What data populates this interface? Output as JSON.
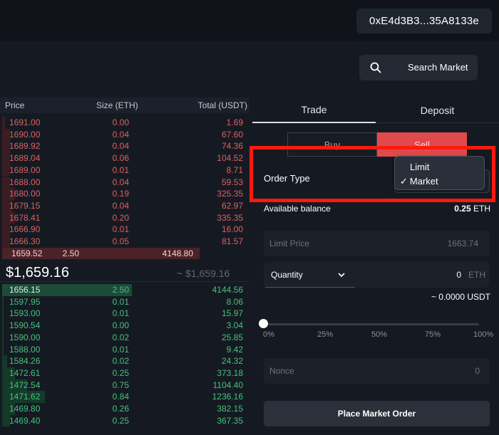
{
  "header": {
    "wallet_address": "0xE4d3B3...35A8133e"
  },
  "search": {
    "label": "Search Market",
    "icon": "search-icon"
  },
  "orderbook": {
    "columns": {
      "price": "Price",
      "size": "Size (ETH)",
      "total": "Total (USDT)"
    },
    "asks": [
      {
        "price": "1691.00",
        "size": "0.00",
        "total": "1.69",
        "depth": 0.01
      },
      {
        "price": "1690.00",
        "size": "0.04",
        "total": "67.60",
        "depth": 0.03
      },
      {
        "price": "1689.92",
        "size": "0.04",
        "total": "74.36",
        "depth": 0.03
      },
      {
        "price": "1689.04",
        "size": "0.06",
        "total": "104.52",
        "depth": 0.03
      },
      {
        "price": "1689.00",
        "size": "0.01",
        "total": "8.71",
        "depth": 0.03
      },
      {
        "price": "1688.00",
        "size": "0.04",
        "total": "59.53",
        "depth": 0.03
      },
      {
        "price": "1680.00",
        "size": "0.19",
        "total": "325.35",
        "depth": 0.05
      },
      {
        "price": "1679.15",
        "size": "0.04",
        "total": "62.97",
        "depth": 0.04
      },
      {
        "price": "1678.41",
        "size": "0.20",
        "total": "335.35",
        "depth": 0.05
      },
      {
        "price": "1666.90",
        "size": "0.01",
        "total": "16.00",
        "depth": 0.03
      },
      {
        "price": "1666.30",
        "size": "0.05",
        "total": "81.57",
        "depth": 0.03
      },
      {
        "price": "1659.52",
        "size": "2.50",
        "total": "4148.80",
        "depth": 0.78
      }
    ],
    "last_price": "$1,659.16",
    "mark_price": "~ $1,659.16",
    "bids": [
      {
        "price": "1656.15",
        "size": "2.50",
        "total": "4144.56",
        "depth": 0.52
      },
      {
        "price": "1597.95",
        "size": "0.01",
        "total": "8.06",
        "depth": 0.0
      },
      {
        "price": "1593.00",
        "size": "0.01",
        "total": "15.97",
        "depth": 0.0
      },
      {
        "price": "1590.54",
        "size": "0.00",
        "total": "3.04",
        "depth": 0.0
      },
      {
        "price": "1590.00",
        "size": "0.02",
        "total": "25.85",
        "depth": 0.0
      },
      {
        "price": "1588.00",
        "size": "0.01",
        "total": "9.42",
        "depth": 0.0
      },
      {
        "price": "1584.26",
        "size": "0.02",
        "total": "24.32",
        "depth": 0.02
      },
      {
        "price": "1472.61",
        "size": "0.25",
        "total": "373.18",
        "depth": 0.05
      },
      {
        "price": "1472.54",
        "size": "0.75",
        "total": "1104.40",
        "depth": 0.1
      },
      {
        "price": "1471.62",
        "size": "0.84",
        "total": "1236.16",
        "depth": 0.17
      },
      {
        "price": "1469.80",
        "size": "0.26",
        "total": "382.15",
        "depth": 0.05
      },
      {
        "price": "1469.40",
        "size": "0.25",
        "total": "367.35",
        "depth": 0.03
      }
    ]
  },
  "tabs": [
    {
      "label": "Trade",
      "active": true
    },
    {
      "label": "Deposit",
      "active": false
    }
  ],
  "side": {
    "buy": "Buy",
    "sell": "Sell",
    "selected": "Sell"
  },
  "order_type": {
    "label": "Order Type",
    "options": [
      "Limit",
      "Market"
    ],
    "selected": "Market",
    "check": "✓"
  },
  "balance": {
    "label": "Available balance",
    "amount": "0.25",
    "unit": "ETH"
  },
  "limit_price": {
    "label": "Limit Price",
    "value": "1663.74"
  },
  "quantity": {
    "label": "Quantity",
    "value": "0",
    "unit": "ETH",
    "approx": "~ 0.0000 USDT"
  },
  "slider": {
    "marks": [
      "0%",
      "25%",
      "50%",
      "75%",
      "100%"
    ],
    "value_percent": 0
  },
  "nonce": {
    "label": "Nonce",
    "value": "0"
  },
  "submit": {
    "label": "Place Market Order"
  },
  "colors": {
    "ask": "#e0605e",
    "bid": "#45c27b",
    "sell_accent": "#e04a4d",
    "highlight_box": "#ff1a0d"
  }
}
